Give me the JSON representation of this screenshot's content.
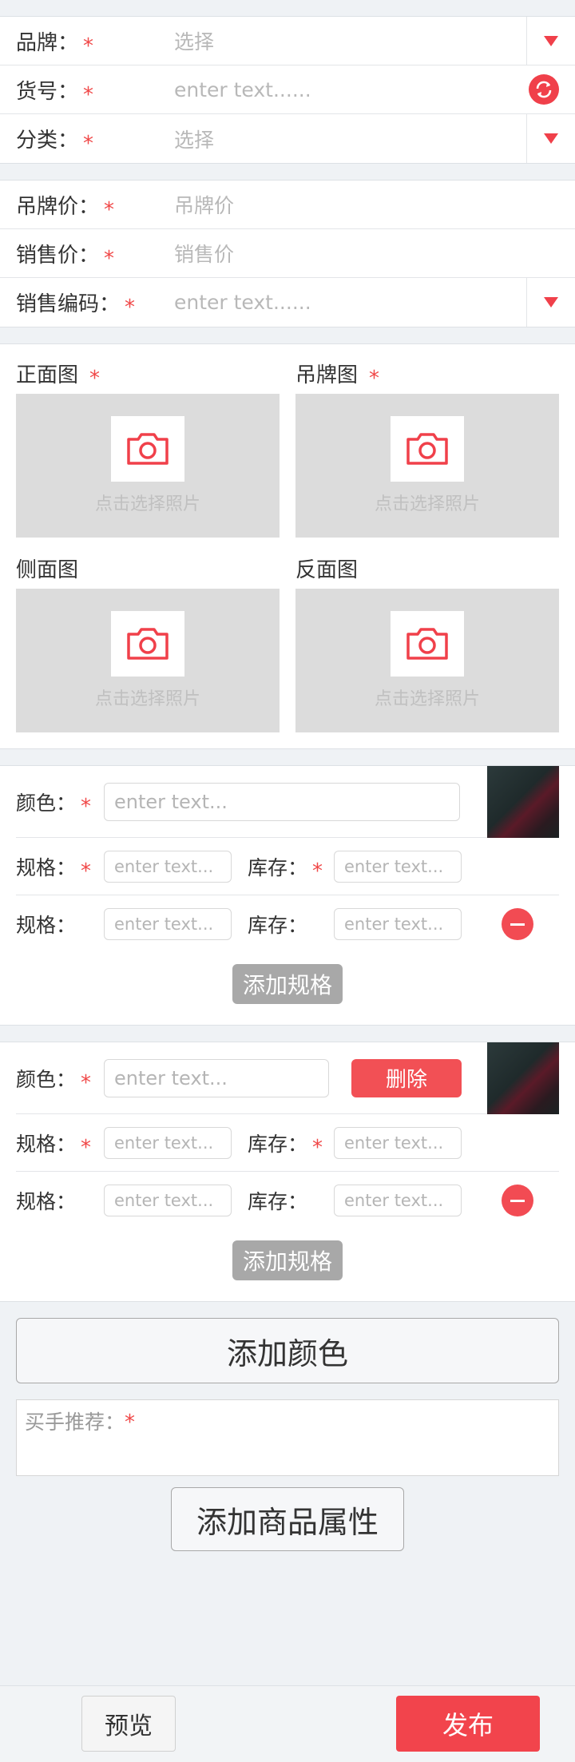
{
  "basic": {
    "brand_label": "品牌：",
    "brand_value": "选择",
    "item_no_label": "货号：",
    "item_no_value": "enter text......",
    "category_label": "分类：",
    "category_value": "选择",
    "required_mark": "*"
  },
  "price": {
    "tag_price_label": "吊牌价：",
    "tag_price_value": "吊牌价",
    "sale_price_label": "销售价：",
    "sale_price_value": "销售价",
    "sale_code_label": "销售编码：",
    "sale_code_value": "enter text......"
  },
  "photos": {
    "front_label": "正面图",
    "tag_label": "吊牌图",
    "side_label": "侧面图",
    "back_label": "反面图",
    "hint": "点击选择照片"
  },
  "color_blocks": [
    {
      "color_label": "颜色：",
      "color_placeholder": "enter text...",
      "spec_label": "规格：",
      "stock_label": "库存：",
      "small_placeholder": "enter text...",
      "add_spec": "添加规格"
    },
    {
      "color_label": "颜色：",
      "color_placeholder": "enter text...",
      "delete_label": "删除",
      "spec_label": "规格：",
      "stock_label": "库存：",
      "small_placeholder": "enter text...",
      "add_spec": "添加规格"
    }
  ],
  "actions": {
    "add_color": "添加颜色",
    "recommend_label": "买手推荐：",
    "add_attribute": "添加商品属性",
    "preview": "预览",
    "publish": "发布"
  },
  "colors": {
    "accent": "#f0404a",
    "placeholder": "#b8b8b8",
    "photo_bg": "#dcdcdc"
  }
}
